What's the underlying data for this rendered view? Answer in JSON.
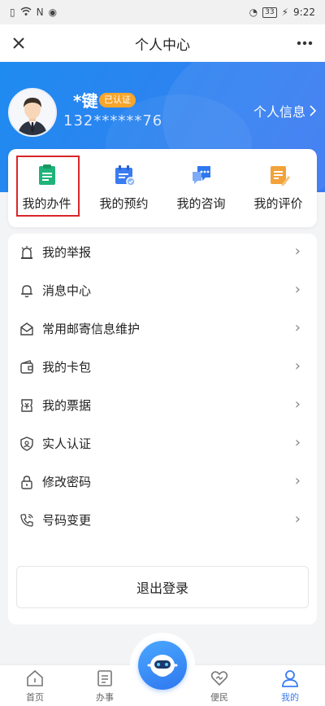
{
  "status_bar": {
    "battery": "33",
    "time": "9:22"
  },
  "header": {
    "title": "个人中心"
  },
  "user": {
    "name": "*键",
    "verified_badge": "已认证",
    "phone": "132******76",
    "profile_link": "个人信息"
  },
  "quick_actions": [
    {
      "label": "我的办件",
      "icon": "document-icon",
      "color": "#1fb37a"
    },
    {
      "label": "我的预约",
      "icon": "calendar-icon",
      "color": "#3a7cf2"
    },
    {
      "label": "我的咨询",
      "icon": "chat-icon",
      "color": "#2f78ef"
    },
    {
      "label": "我的评价",
      "icon": "rating-icon",
      "color": "#f2a23a"
    }
  ],
  "menu": [
    {
      "label": "我的举报",
      "icon": "report-icon"
    },
    {
      "label": "消息中心",
      "icon": "bell-icon"
    },
    {
      "label": "常用邮寄信息维护",
      "icon": "mail-icon"
    },
    {
      "label": "我的卡包",
      "icon": "wallet-icon"
    },
    {
      "label": "我的票据",
      "icon": "ticket-icon"
    },
    {
      "label": "实人认证",
      "icon": "shield-icon"
    },
    {
      "label": "修改密码",
      "icon": "lock-icon"
    },
    {
      "label": "号码变更",
      "icon": "phone-icon"
    }
  ],
  "logout": {
    "label": "退出登录"
  },
  "tabs": [
    {
      "label": "首页",
      "icon": "home-icon"
    },
    {
      "label": "办事",
      "icon": "tasks-icon"
    },
    {
      "label": "便民",
      "icon": "heart-icon"
    },
    {
      "label": "我的",
      "icon": "user-icon",
      "active": true
    }
  ],
  "colors": {
    "primary": "#2f82f0",
    "badge": "#f7a52b",
    "highlight": "#d9262c",
    "active_tab": "#3a7cf2"
  }
}
